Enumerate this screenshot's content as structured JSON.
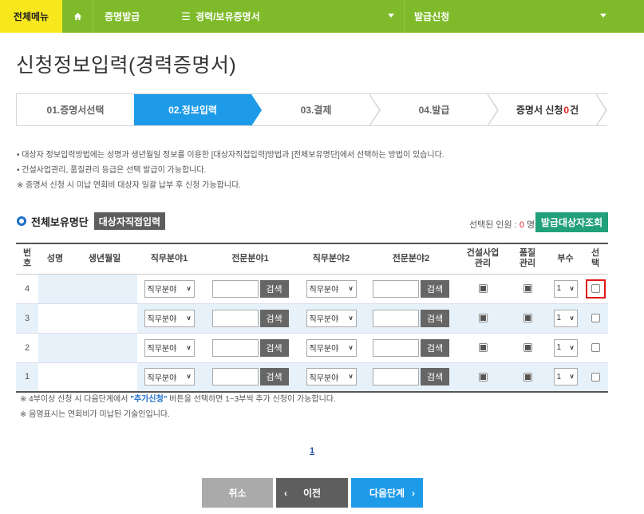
{
  "nav": {
    "menu_all": "전체메뉴",
    "home_icon": "home-icon",
    "seg1": "증명발급",
    "seg2": "경력/보유증명서",
    "seg3": "발급신청"
  },
  "page_title": "신청정보입력(경력증명서)",
  "steps": {
    "s1": "01.증명서선택",
    "s2": "02.정보입력",
    "s3": "03.결제",
    "s4": "04.발급",
    "count_prefix": "증명서 신청 ",
    "count_value": "0",
    "count_suffix": "건"
  },
  "notes": [
    "• 대상자 정보입력방법에는 성명과 생년월일 정보를 이용한 [대상자직접입력]방법과 [전체보유명단]에서 선택하는 방법이 있습니다.",
    "• 건설사업관리, 품질관리 등급은 선택 발급이 가능합니다.",
    "※ 증명서 신청 시 미납 연회비 대상자 일괄 납부 후 신청 가능합니다."
  ],
  "section": {
    "title": "전체보유명단",
    "direct_btn": "대상자직접입력",
    "selected_prefix": "선택된 인원 : ",
    "selected_count": "0",
    "selected_suffix": " 명",
    "lookup_btn": "발급대상자조회"
  },
  "table": {
    "headers": {
      "no": "번호",
      "name": "성명",
      "birth": "생년월일",
      "job1": "직무분야1",
      "spec1": "전문분야1",
      "job2": "직무분야2",
      "spec2": "전문분야2",
      "cm": "건설사업관리",
      "qc": "품질관리",
      "copies": "부수",
      "select": "선택"
    },
    "select_placeholder": "직무분야",
    "search_label": "검색",
    "rows": [
      {
        "no": "4",
        "copies": "1"
      },
      {
        "no": "3",
        "copies": "1"
      },
      {
        "no": "2",
        "copies": "1"
      },
      {
        "no": "1",
        "copies": "1"
      }
    ]
  },
  "footnotes": {
    "line1_a": "※ 4부이상 신청 시 다음단계에서 ",
    "line1_b": "\"추가신청\"",
    "line1_c": " 버튼을 선택하면 1~3부씩 추가 신청이 가능합니다.",
    "line2": "※ 음영표시는 연회비가 미납된 기술인입니다."
  },
  "pager": "1",
  "buttons": {
    "cancel": "취소",
    "prev": "이전",
    "next": "다음단계"
  }
}
